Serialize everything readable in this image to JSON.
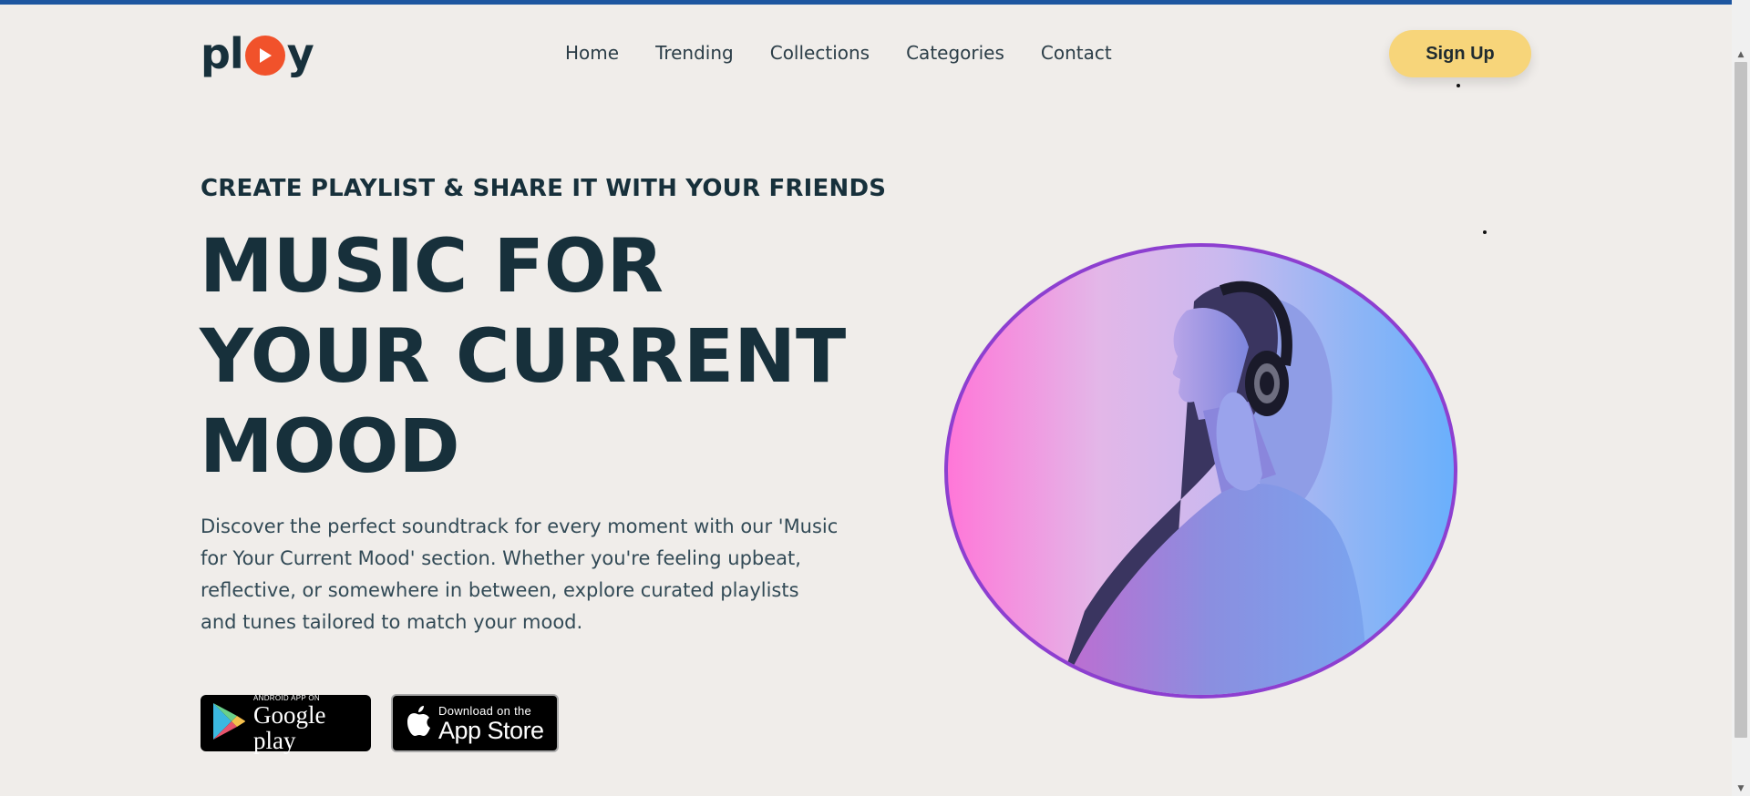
{
  "brand": {
    "logo_left": "pl",
    "logo_right": "y",
    "play_icon": "play-icon"
  },
  "nav": {
    "items": [
      {
        "label": "Home"
      },
      {
        "label": "Trending"
      },
      {
        "label": "Collections"
      },
      {
        "label": "Categories"
      },
      {
        "label": "Contact"
      }
    ]
  },
  "header": {
    "signup_label": "Sign Up"
  },
  "hero": {
    "subtitle": "CREATE PLAYLIST & SHARE IT WITH YOUR FRIENDS",
    "headline_lines": [
      "MUSIC FOR",
      "YOUR CURRENT",
      "MOOD"
    ],
    "description": "Discover the perfect soundtrack for every moment with our 'Music for Your Current Mood' section. Whether you're feeling upbeat, reflective, or somewhere in between, explore curated playlists and tunes tailored to match your mood.",
    "image_subject": "woman-with-headphones"
  },
  "stores": {
    "google": {
      "small": "ANDROID APP ON",
      "big": "Google play",
      "icon": "google-play-icon"
    },
    "apple": {
      "small": "Download on the",
      "big": "App Store",
      "icon": "apple-icon"
    }
  },
  "colors": {
    "accent": "#f1522b",
    "signup": "#f7d57a",
    "text_dark": "#17303b",
    "background": "#f0edea",
    "hero_border": "#8d3fd0",
    "top_bar": "#1d56a0"
  }
}
